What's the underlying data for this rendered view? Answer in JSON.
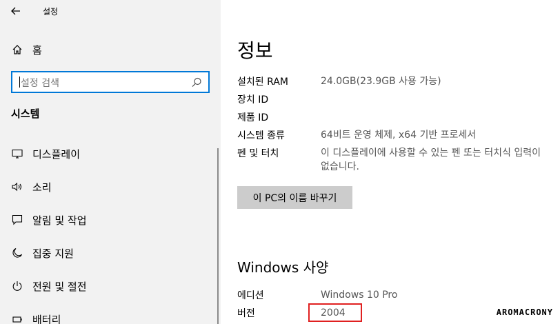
{
  "app": {
    "title": "설정"
  },
  "sidebar": {
    "home_label": "홈",
    "search_placeholder": "설정 검색",
    "section_title": "시스템",
    "items": [
      {
        "label": "디스플레이",
        "icon": "monitor-icon"
      },
      {
        "label": "소리",
        "icon": "speaker-icon"
      },
      {
        "label": "알림 및 작업",
        "icon": "notification-icon"
      },
      {
        "label": "집중 지원",
        "icon": "moon-icon"
      },
      {
        "label": "전원 및 절전",
        "icon": "power-icon"
      },
      {
        "label": "배터리",
        "icon": "battery-icon"
      }
    ]
  },
  "main": {
    "title": "정보",
    "specs": [
      {
        "key": "설치된 RAM",
        "value": "24.0GB(23.9GB 사용 가능)"
      },
      {
        "key": "장치 ID",
        "value": ""
      },
      {
        "key": "제품 ID",
        "value": ""
      },
      {
        "key": "시스템 종류",
        "value": "64비트 운영 체제, x64 기반 프로세서"
      },
      {
        "key": "펜 및 터치",
        "value": "이 디스플레이에 사용할 수 있는 펜 또는 터치식 입력이 없습니다."
      }
    ],
    "rename_button": "이 PC의 이름 바꾸기",
    "windows_section_title": "Windows 사양",
    "windows_specs": [
      {
        "key": "에디션",
        "value": "Windows 10 Pro"
      },
      {
        "key": "버전",
        "value": "2004"
      }
    ]
  },
  "watermark": "AROMACRONY",
  "colors": {
    "accent": "#0078d7",
    "highlight": "#e02020",
    "sidebar_bg": "#f2f2f2"
  }
}
